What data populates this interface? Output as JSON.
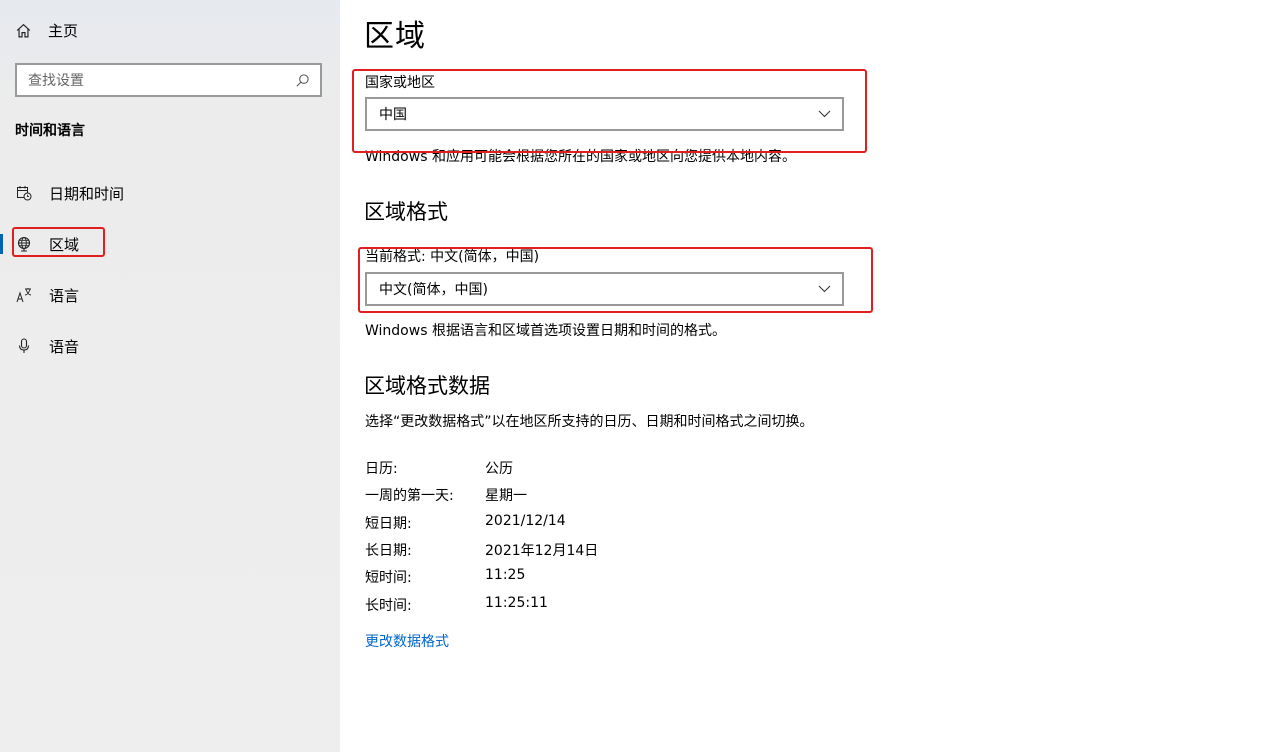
{
  "sidebar": {
    "home_label": "主页",
    "search_placeholder": "查找设置",
    "section_title": "时间和语言",
    "items": [
      {
        "label": "日期和时间",
        "icon": "calendar-clock-icon"
      },
      {
        "label": "区域",
        "icon": "globe-icon",
        "active": true
      },
      {
        "label": "语言",
        "icon": "language-icon"
      },
      {
        "label": "语音",
        "icon": "microphone-icon"
      }
    ]
  },
  "main": {
    "title": "区域",
    "country": {
      "label": "国家或地区",
      "value": "中国",
      "description": "Windows 和应用可能会根据您所在的国家或地区向您提供本地内容。"
    },
    "format": {
      "heading": "区域格式",
      "label": "当前格式: 中文(简体，中国)",
      "value": "中文(简体，中国)",
      "description": "Windows 根据语言和区域首选项设置日期和时间的格式。"
    },
    "format_data": {
      "heading": "区域格式数据",
      "description": "选择“更改数据格式”以在地区所支持的日历、日期和时间格式之间切换。",
      "rows": [
        {
          "key": "日历:",
          "value": "公历"
        },
        {
          "key": "一周的第一天:",
          "value": "星期一"
        },
        {
          "key": "短日期:",
          "value": "2021/12/14"
        },
        {
          "key": "长日期:",
          "value": "2021年12月14日"
        },
        {
          "key": "短时间:",
          "value": "11:25"
        },
        {
          "key": "长时间:",
          "value": "11:25:11"
        }
      ],
      "link": "更改数据格式"
    }
  },
  "colors": {
    "highlight": "#e02020",
    "accent": "#0063b1",
    "link": "#0066cc"
  }
}
